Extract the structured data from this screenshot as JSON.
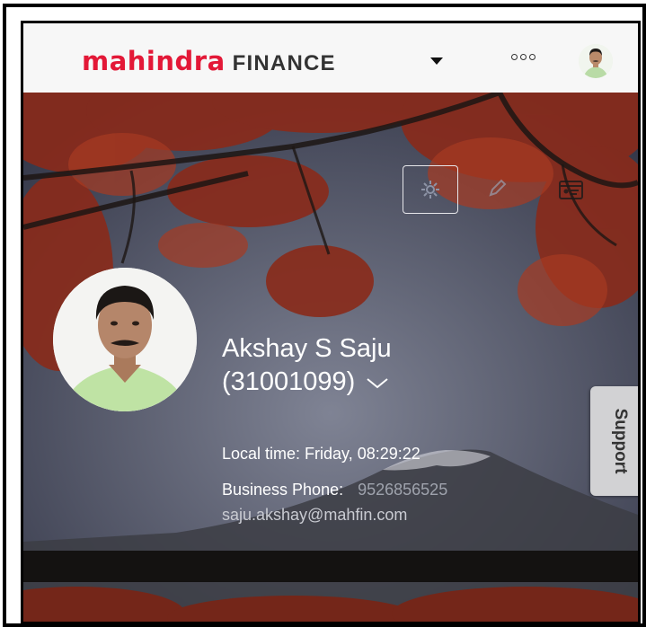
{
  "header": {
    "brand": "mahindra",
    "brand_suffix": "FINANCE",
    "brand_color": "#e31837",
    "menu_icon": "chevron-down-icon",
    "more_icon": "more-dots-icon",
    "avatar_icon": "user-avatar"
  },
  "toolbar": {
    "icons": [
      "settings-gear-icon",
      "pencil-icon",
      "id-card-icon"
    ]
  },
  "profile": {
    "name": "Akshay S Saju",
    "employee_id": "(31001099)",
    "local_time": "Local time: Friday, 08:29:22",
    "business_phone_label": "Business Phone:",
    "business_phone": "9526856525",
    "email": "saju.akshay@mahfin.com"
  },
  "support": {
    "label": "Support"
  }
}
